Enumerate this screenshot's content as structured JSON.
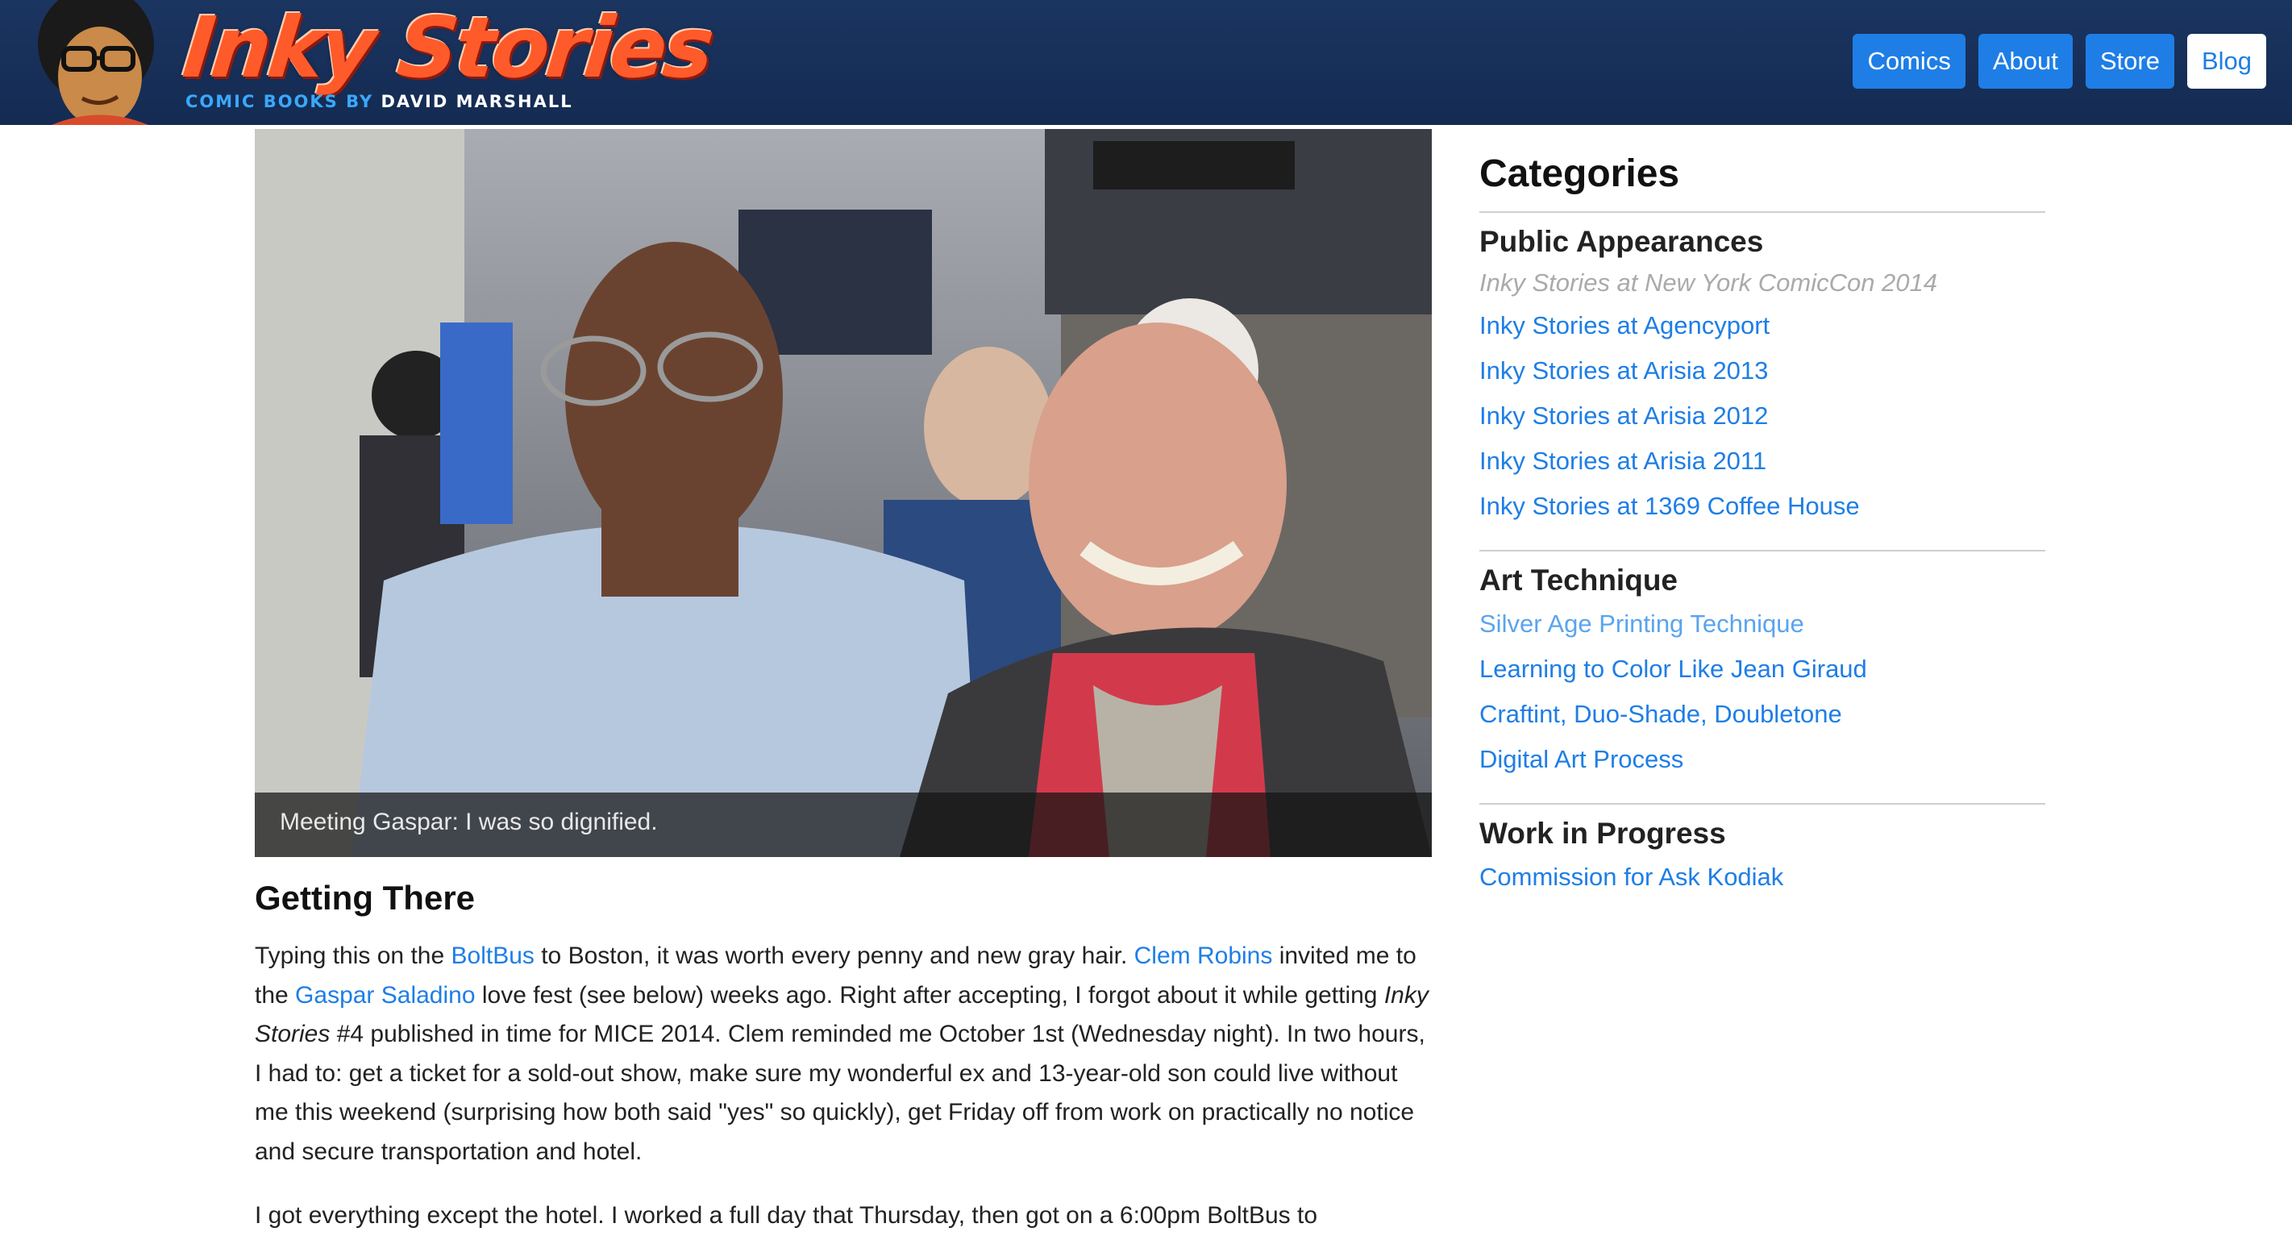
{
  "header": {
    "logo_title": "Inky Stories",
    "logo_sub_prefix": "COMIC BOOKS BY",
    "logo_sub_name": "DAVID MARSHALL",
    "nav": [
      {
        "label": "Comics",
        "active": false
      },
      {
        "label": "About",
        "active": false
      },
      {
        "label": "Store",
        "active": false
      },
      {
        "label": "Blog",
        "active": true
      }
    ]
  },
  "photo": {
    "caption": "Meeting Gaspar: I was so dignified."
  },
  "article": {
    "heading": "Getting There",
    "p1": {
      "t1": "Typing this on the ",
      "link1": "BoltBus",
      "t2": " to Boston, it was worth every penny and new gray hair. ",
      "link2": "Clem Robins",
      "t3": " invited me to the ",
      "link3": "Gaspar Saladino",
      "t4": " love fest (see below) weeks ago. Right after accepting, I forgot about it while getting ",
      "italic": "Inky Stories",
      "t5": " #4 published in time for MICE 2014. Clem reminded me October 1st (Wednesday night). In two hours, I had to: get a ticket for a sold-out show, make sure my wonderful ex and 13-year-old son could live without me this weekend (surprising how both said \"yes\" so quickly), get Friday off from work on practically no notice and secure transportation and hotel."
    },
    "p2": "I got everything except the hotel. I worked a full day that Thursday, then got on a 6:00pm BoltBus to"
  },
  "sidebar": {
    "title": "Categories",
    "groups": [
      {
        "heading": "Public Appearances",
        "links": [
          "Inky Stories at New York ComicCon 2014",
          "Inky Stories at Agencyport",
          "Inky Stories at Arisia 2013",
          "Inky Stories at Arisia 2012",
          "Inky Stories at Arisia 2011",
          "Inky Stories at 1369 Coffee House"
        ]
      },
      {
        "heading": "Art Technique",
        "links": [
          "Silver Age Printing Technique",
          "Learning to Color Like Jean Giraud",
          "Craftint, Duo-Shade, Doubletone",
          "Digital Art Process"
        ]
      },
      {
        "heading": "Work in Progress",
        "links": [
          "Commission for Ask Kodiak"
        ]
      }
    ]
  },
  "colors": {
    "header_bg": "#142b52",
    "nav_button": "#1e7ee6",
    "link": "#1e7ee6",
    "logo": "#ff5a2a"
  }
}
